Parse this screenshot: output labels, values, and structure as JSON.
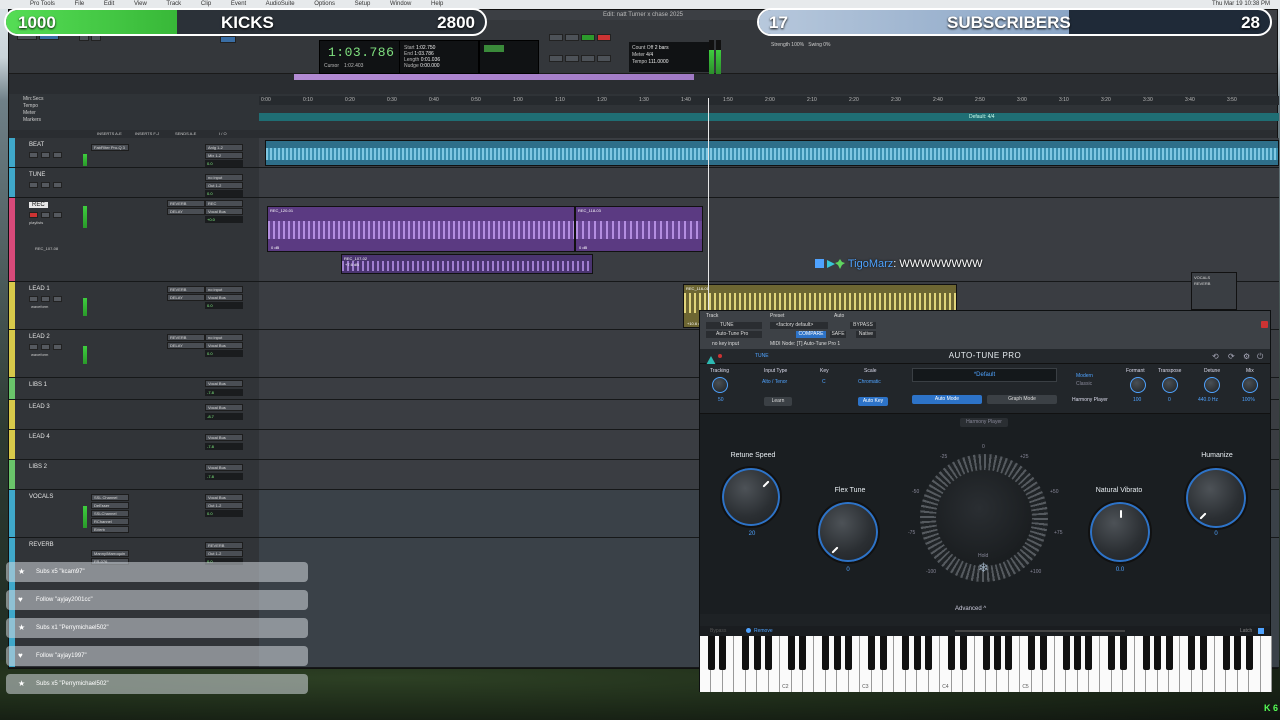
{
  "os_menubar": {
    "items": [
      "Pro Tools",
      "File",
      "Edit",
      "View",
      "Track",
      "Clip",
      "Event",
      "AudioSuite",
      "Options",
      "Setup",
      "Window",
      "Help"
    ],
    "datetime": "Thu Mar 19 10:38 PM"
  },
  "protools": {
    "window_title": "Edit: natt Turner x chase 2025",
    "counter": "1:03.786",
    "counter_sub": [
      "Start",
      "End",
      "Length"
    ],
    "start": "1:02.750",
    "end": "1:03.786",
    "length": "0:01.036",
    "cursor_label": "Cursor",
    "cursor_value": "1:02.403",
    "nudge_label": "Nudge",
    "nudge_value": "0:00.000",
    "count_off": "Count Off",
    "meter": "Meter",
    "tempo": "Tempo",
    "bars": "2 bars",
    "time_sig": "4/4",
    "tempo_val": "111.0000",
    "strength": "Strength",
    "swing": "Swing",
    "strength_val": "100%",
    "swing_val": "0%",
    "rulers": [
      "Min:Secs",
      "Tempo",
      "Meter",
      "Markers"
    ],
    "ruler_ticks": [
      "0:00",
      "0:10",
      "0:20",
      "0:30",
      "0:40",
      "0:50",
      "1:00",
      "1:10",
      "1:20",
      "1:30",
      "1:40",
      "1:50",
      "2:00",
      "2:10",
      "2:20",
      "2:30",
      "2:40",
      "2:50",
      "3:00",
      "3:10",
      "3:20",
      "3:30",
      "3:40",
      "3:50"
    ],
    "tempo_ruler_label": "Default: 4/4",
    "column_headers": [
      "INSERTS A-E",
      "INSERTS F-J",
      "SENDS A-E",
      "I / O"
    ]
  },
  "tracks": [
    {
      "name": "BEAT",
      "color": "#3fa7c9",
      "inserts": [
        "FabFilter Pro-Q 3"
      ],
      "io": [
        "Anlg 1-2",
        "Mix 1-2"
      ],
      "vol": "0.0"
    },
    {
      "name": "TUNE",
      "color": "#3fa7c9",
      "inserts": [],
      "io": [
        "no input",
        "Out 1-2"
      ],
      "vol": "0.0"
    },
    {
      "name": "REC",
      "color": "#d84a7a",
      "inserts": [
        "REVERB",
        "DELAY"
      ],
      "io": [
        "REC",
        "Vocal Bus"
      ],
      "vol": "+0.0",
      "playlist": "playlists",
      "alt": "REC_107-08"
    },
    {
      "name": "LEAD 1",
      "color": "#d8c94a",
      "inserts": [
        "REVERB",
        "DELAY"
      ],
      "io": [
        "no input",
        "Vocal Bus"
      ],
      "vol": "0.0",
      "view": "waveform"
    },
    {
      "name": "LEAD 2",
      "color": "#d8c94a",
      "inserts": [
        "REVERB",
        "DELAY"
      ],
      "io": [
        "no input",
        "Vocal Bus"
      ],
      "vol": "0.0",
      "view": "waveform"
    },
    {
      "name": "LIBS 1",
      "color": "#6ac46a",
      "inserts": [],
      "io": [
        "no input",
        "Vocal Bus"
      ],
      "vol": "-7.8"
    },
    {
      "name": "LEAD 3",
      "color": "#d8c94a",
      "inserts": [],
      "io": [
        "no input",
        "Vocal Bus"
      ],
      "vol": "-8.7"
    },
    {
      "name": "LEAD 4",
      "color": "#d8c94a",
      "inserts": [],
      "io": [
        "no input",
        "Vocal Bus"
      ],
      "vol": "-7.8"
    },
    {
      "name": "LIBS 2",
      "color": "#6ac46a",
      "inserts": [],
      "io": [
        "no input",
        "Vocal Bus"
      ],
      "vol": "-7.8"
    },
    {
      "name": "VOCALS",
      "color": "#3fa7c9",
      "inserts": [
        "SSL Channel",
        "DeEsser",
        "SSLChannel",
        "RChannel",
        "BVerb"
      ],
      "io": [
        "Vocal Bus",
        "Out 1-2"
      ],
      "vol": "0.0"
    },
    {
      "name": "REVERB",
      "color": "#3fa7c9",
      "inserts": [
        "Manny/Marroquin",
        "FR-076"
      ],
      "io": [
        "REVERB",
        "Out 1-2"
      ],
      "vol": "0.0"
    }
  ],
  "clips": [
    {
      "label": "REC_120-01",
      "gain": "0 dB"
    },
    {
      "label": "REC_118-03",
      "gain": "0 dB"
    },
    {
      "label": "REC_107-02",
      "gain": "+7.6 dB"
    },
    {
      "label": "REC_116-01",
      "gain": "+10.6 dB"
    }
  ],
  "overlay": {
    "kicks_current": "1000",
    "kicks_label": "KICKS",
    "kicks_goal": "2800",
    "kicks_progress": 0.357,
    "subs_current": "17",
    "subs_label": "SUBSCRIBERS",
    "subs_goal": "28",
    "subs_progress": 0.607,
    "chat_user": "TigoMarz",
    "chat_message": ": WWWWWWWW",
    "alerts": [
      {
        "text": "Subs x5 \"kcam97\"",
        "icon": "star-icon"
      },
      {
        "text": "Follow \"ayjay2001cc\"",
        "icon": "heart-icon"
      },
      {
        "text": "Subs x1 \"Perrymichael502\"",
        "icon": "star-icon"
      },
      {
        "text": "Follow \"ayjay1997\"",
        "icon": "heart-icon"
      },
      {
        "text": "Subs x5 \"Perrymichael502\"",
        "icon": "star-icon"
      }
    ],
    "kick_badge": "K 6"
  },
  "plugin": {
    "track_label": "Track",
    "preset_label": "Preset",
    "auto_label": "Auto",
    "track_value": "TUNE",
    "insert_value": "Auto-Tune Pro",
    "preset_value": "<factory default>",
    "compare": "COMPARE",
    "bypass": "BYPASS",
    "safe": "SAFE",
    "native": "Native",
    "midi_node": "MIDI Node: [T] Auto-Tune Pro 1",
    "key_input": "no key input",
    "title": "AUTO-TUNE PRO",
    "tab": "TUNE",
    "tracking_label": "Tracking",
    "tracking_val": "50",
    "input_type_label": "Input Type",
    "input_type_val": "Alto / Tenor",
    "key_label": "Key",
    "key_val": "C",
    "scale_label": "Scale",
    "scale_val": "Chromatic",
    "learn": "Learn",
    "auto_key": "Auto Key",
    "preset_name": "*Default",
    "auto_mode": "Auto Mode",
    "graph_mode": "Graph Mode",
    "modern": "Modern",
    "classic": "Classic",
    "harmony_player": "Harmony Player",
    "formant_label": "Formant",
    "formant_val": "100",
    "transpose_label": "Transpose",
    "transpose_val": "0",
    "detune_label": "Detune",
    "detune_val": "440.0 Hz",
    "mix_label": "Mix",
    "mix_val": "100%",
    "harmony_btn": "Harmony Player",
    "retune_label": "Retune Speed",
    "retune_val": "20",
    "flex_label": "Flex Tune",
    "flex_val": "0",
    "vibrato_label": "Natural Vibrato",
    "vibrato_val": "0.0",
    "humanize_label": "Humanize",
    "humanize_val": "0",
    "dial_marks": [
      "0",
      "-25",
      "+25",
      "-50",
      "+50",
      "-75",
      "+75",
      "-100",
      "+100"
    ],
    "hold": "Hold",
    "advanced": "Advanced",
    "piano_bypass": "Bypass",
    "piano_remove": "Remove",
    "piano_latch": "Latch",
    "octaves": [
      "C2",
      "C3",
      "C4",
      "C5"
    ]
  },
  "colors": {
    "accent": "#4fa3ff",
    "kicks_fill": "#4fd64f",
    "subs_fill": "#a6bad3"
  }
}
